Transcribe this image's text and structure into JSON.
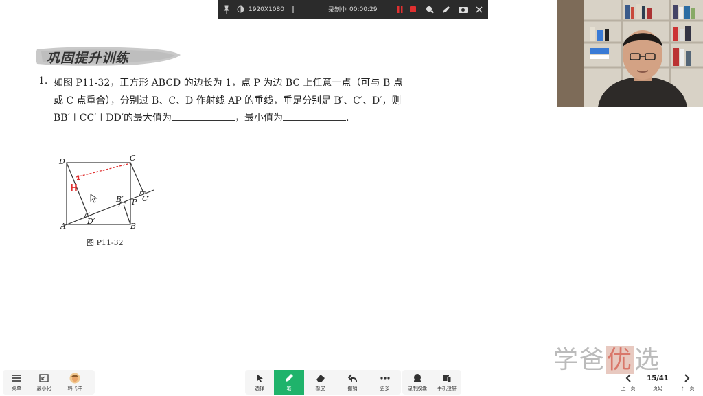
{
  "recorder": {
    "resolution": "1920X1080",
    "status": "录制中",
    "time": "00:00:29"
  },
  "banner": {
    "title": "巩固提升训练"
  },
  "question": {
    "number": "1.",
    "line1": "如图 P11-32，正方形 ABCD 的边长为 1，点 P 为边 BC 上任意一点（可与 B 点",
    "line2": "或 C 点重合），分别过 B、C、D 作射线 AP 的垂线，垂足分别是 B′、C′、D′，则",
    "line3_a": "BB′＋CC′＋DD′的最大值为",
    "line3_b": "，最小值为",
    "line3_c": "."
  },
  "figure": {
    "caption": "图 P11-32",
    "labels": {
      "A": "A",
      "B": "B",
      "C": "C",
      "D": "D",
      "P": "P",
      "Bp": "B′",
      "Cp": "C′",
      "Dp": "D′"
    },
    "annotation_h": "H",
    "annotation_1": "1"
  },
  "toolbar_left": [
    {
      "label": "菜单",
      "icon": "menu-icon"
    },
    {
      "label": "最小化",
      "icon": "minimize-icon"
    },
    {
      "label": "韩飞洋",
      "icon": "avatar"
    }
  ],
  "toolbar_center": [
    {
      "label": "选择",
      "icon": "pointer-icon"
    },
    {
      "label": "笔",
      "icon": "pen-icon",
      "active": true
    },
    {
      "label": "橡皮",
      "icon": "eraser-icon"
    },
    {
      "label": "撤销",
      "icon": "undo-icon"
    },
    {
      "label": "更多",
      "icon": "more-icon"
    }
  ],
  "toolbar_right": [
    {
      "label": "录制胶囊",
      "icon": "record-capsule-icon"
    },
    {
      "label": "手机投屏",
      "icon": "phone-cast-icon"
    }
  ],
  "pager": {
    "prev": "上一页",
    "page_label": "页码",
    "next": "下一页",
    "current": "15/41"
  },
  "watermark": {
    "a": "学爸",
    "b": "优",
    "c": "选"
  },
  "colors": {
    "active_green": "#1fb36b",
    "annotation_red": "#e03030"
  }
}
